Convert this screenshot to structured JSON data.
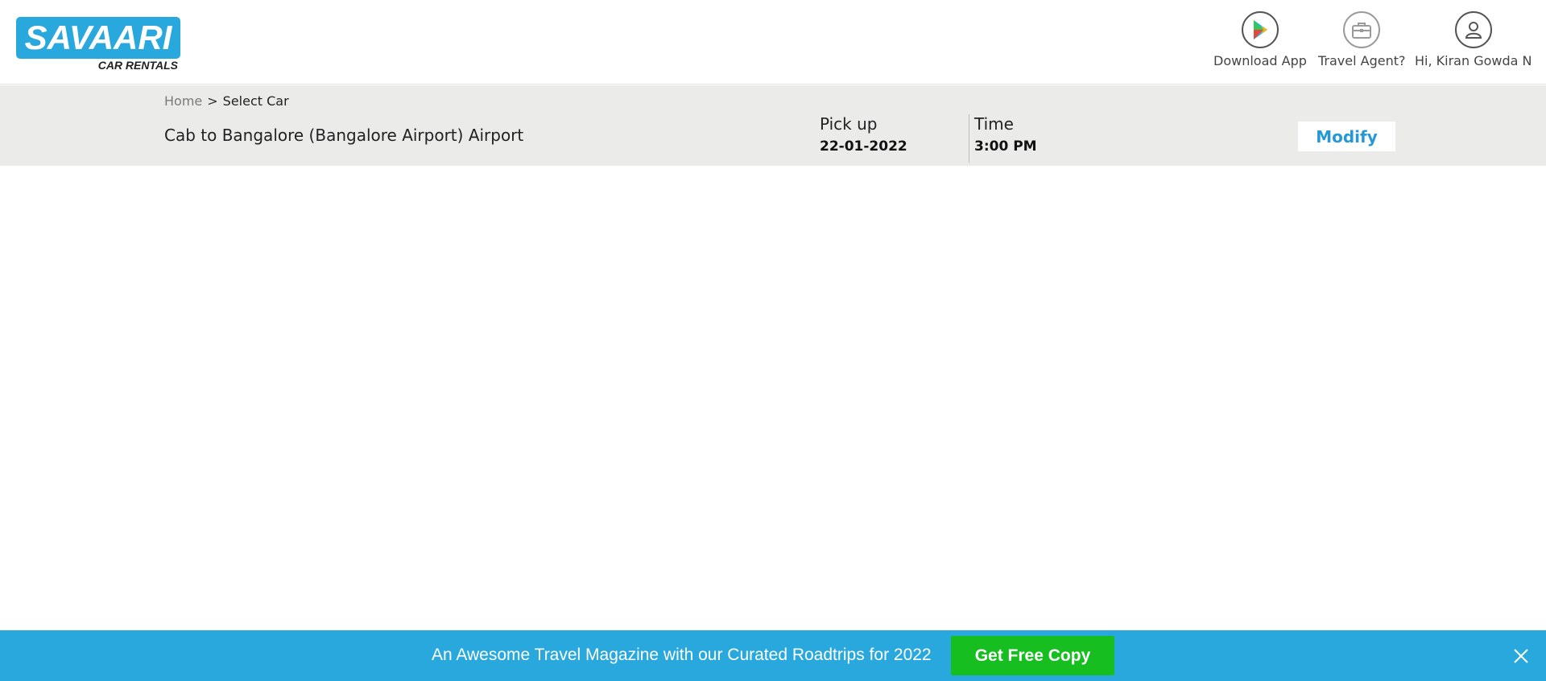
{
  "brand": {
    "logo_title": "SAVAARI",
    "logo_subtitle": "CAR RENTALS",
    "accent_color": "#28a8dd"
  },
  "header": {
    "download_app": {
      "label": "Download App",
      "icon": "google-play-icon"
    },
    "travel_agent": {
      "label": "Travel Agent?",
      "icon": "briefcase-icon"
    },
    "user": {
      "label": "Hi, Kiran Gowda N",
      "icon": "user-icon"
    }
  },
  "breadcrumb": {
    "home": "Home",
    "separator": ">",
    "current": "Select Car"
  },
  "trip": {
    "route": "Cab to Bangalore (Bangalore Airport) Airport",
    "pickup_label": "Pick up",
    "pickup_date": "22-01-2022",
    "time_label": "Time",
    "time_value": "3:00 PM",
    "modify_label": "Modify"
  },
  "promo": {
    "text": "An Awesome Travel Magazine with our Curated Roadtrips for 2022",
    "button_label": "Get Free Copy",
    "button_color": "#16bf1f",
    "close_icon": "close-icon"
  }
}
